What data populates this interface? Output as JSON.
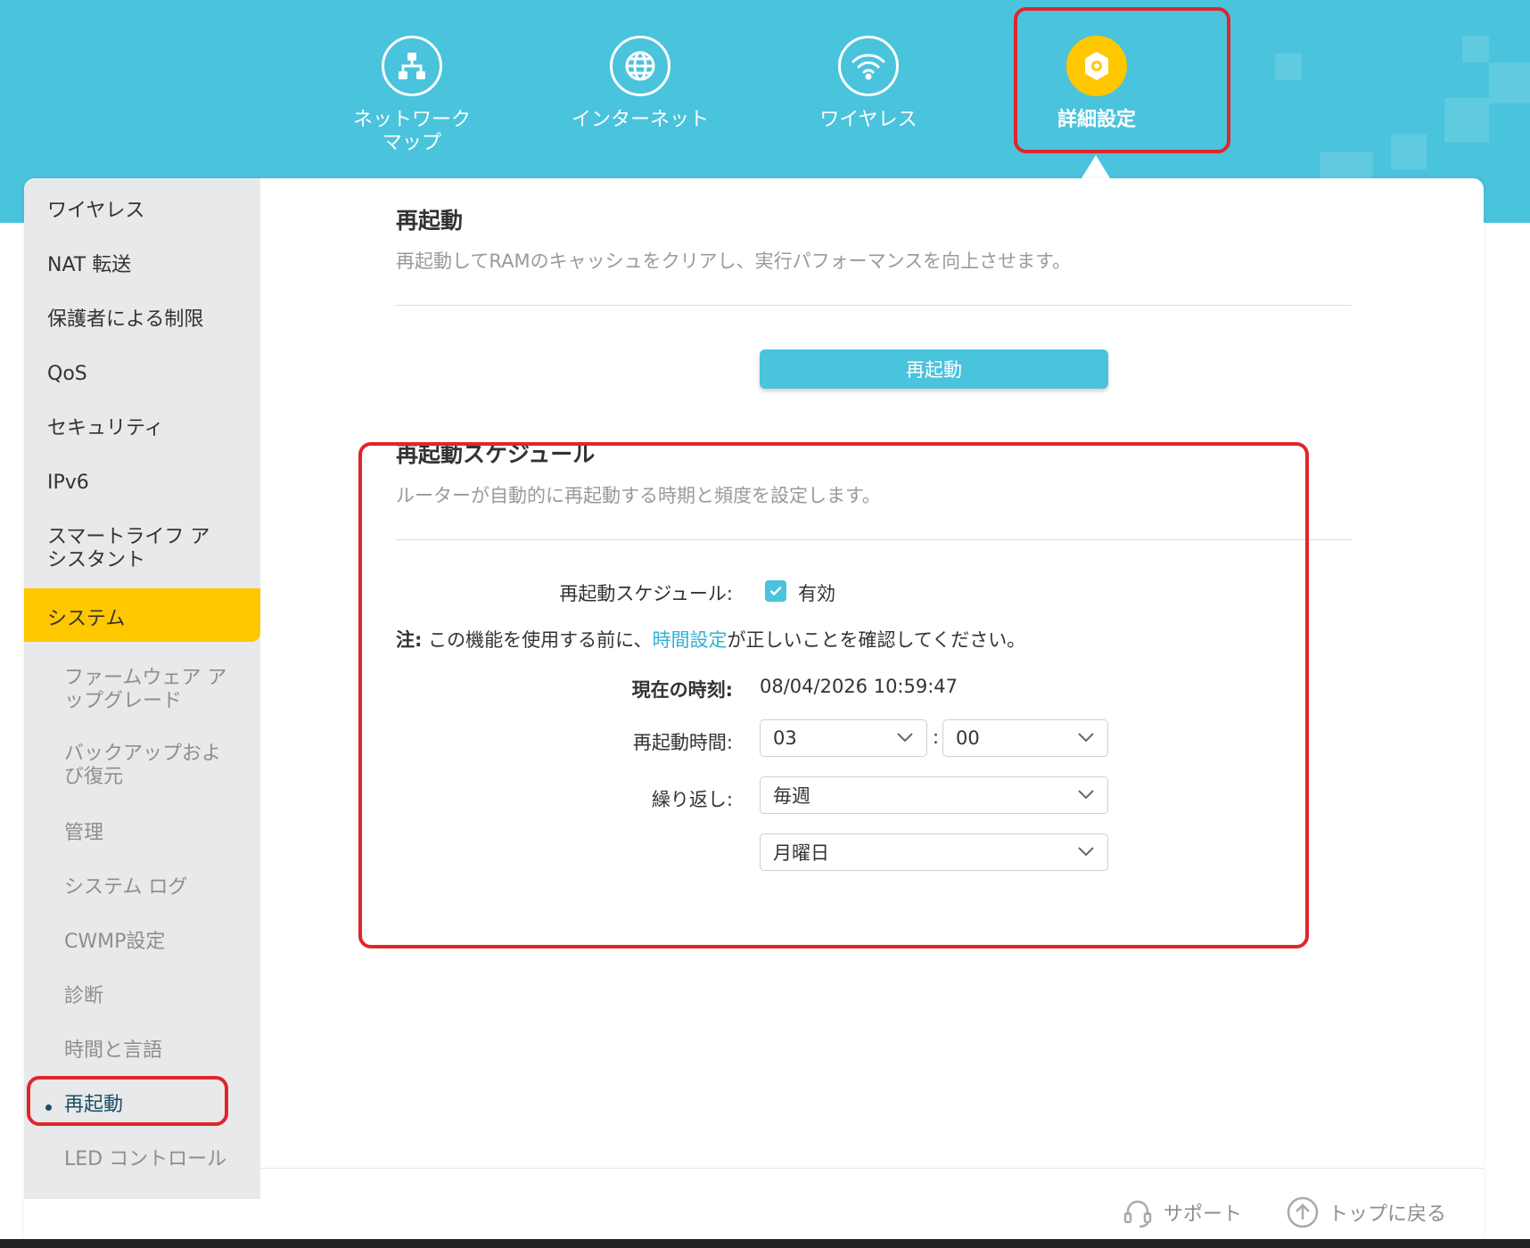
{
  "nav": {
    "items": [
      {
        "label": "ネットワーク\nマップ",
        "icon": "network-map-icon"
      },
      {
        "label": "インターネット",
        "icon": "globe-icon"
      },
      {
        "label": "ワイヤレス",
        "icon": "wifi-icon"
      },
      {
        "label": "詳細設定",
        "icon": "gear-icon",
        "active": true
      }
    ]
  },
  "sidebar": {
    "items": [
      "ワイヤレス",
      "NAT 転送",
      "保護者による制限",
      "QoS",
      "セキュリティ",
      "IPv6",
      "スマートライフ ア\nシスタント",
      "システム"
    ],
    "subitems": [
      "ファームウェア ア\nップグレード",
      "バックアップおよ\nび復元",
      "管理",
      "システム ログ",
      "CWMP設定",
      "診断",
      "時間と言語",
      "再起動",
      "LED コントロール"
    ]
  },
  "reboot": {
    "title": "再起動",
    "description": "再起動してRAMのキャッシュをクリアし、実行パフォーマンスを向上させます。",
    "button": "再起動"
  },
  "schedule": {
    "title": "再起動スケジュール",
    "description": "ルーターが自動的に再起動する時期と頻度を設定します。",
    "enable_label": "再起動スケジュール:",
    "enable_value": "有効",
    "note_prefix": "注:",
    "note_before": " この機能を使用する前に、",
    "note_link": "時間設定",
    "note_after": "が正しいことを確認してください。",
    "current_time_label": "現在の時刻:",
    "current_time_value": "08/04/2026 10:59:47",
    "reboot_time_label": "再起動時間:",
    "hour": "03",
    "colon": ":",
    "minute": "00",
    "repeat_label": "繰り返し:",
    "repeat": "毎週",
    "day": "月曜日"
  },
  "footer": {
    "support": "サポート",
    "back_to_top": "トップに戻る"
  },
  "colors": {
    "accent": "#4ac3dc",
    "active": "#ffc700",
    "highlight": "#e0262b"
  }
}
